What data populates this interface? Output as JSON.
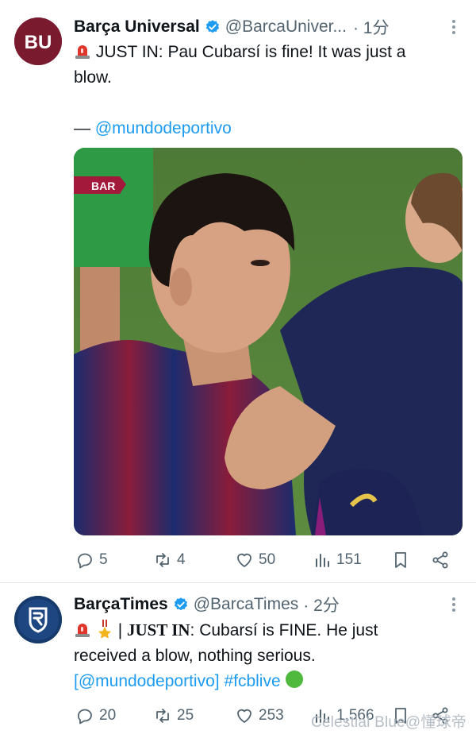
{
  "tweets": [
    {
      "author": "Barça Universal",
      "handle": "@BarcaUniver...",
      "time": "· 1分",
      "avatar_text": "BU",
      "line1": "JUST IN: Pau Cubarsí is fine! It was just a",
      "line2": "blow.",
      "source_prefix": "— ",
      "source_link": "@mundodeportivo",
      "media_badge": "BAR",
      "actions": {
        "replies": "5",
        "retweets": "4",
        "likes": "50",
        "views": "151"
      }
    },
    {
      "author": "BarçaTimes",
      "handle": "@BarcaTimes",
      "time": "· 2分",
      "line1_bold": "JUST IN",
      "line1_rest": ": Cubarsí is FINE. He just",
      "line2": "received a blow, nothing serious.",
      "line3_link1": "[@mundodeportivo]",
      "line3_link2": "#fcblive",
      "actions": {
        "replies": "20",
        "retweets": "25",
        "likes": "253",
        "views": "1,566"
      }
    }
  ],
  "watermark": "Celestial Blue@懂球帝",
  "colors": {
    "link": "#1d9bf0",
    "muted": "#536471",
    "verified": "#1d9bf0"
  }
}
